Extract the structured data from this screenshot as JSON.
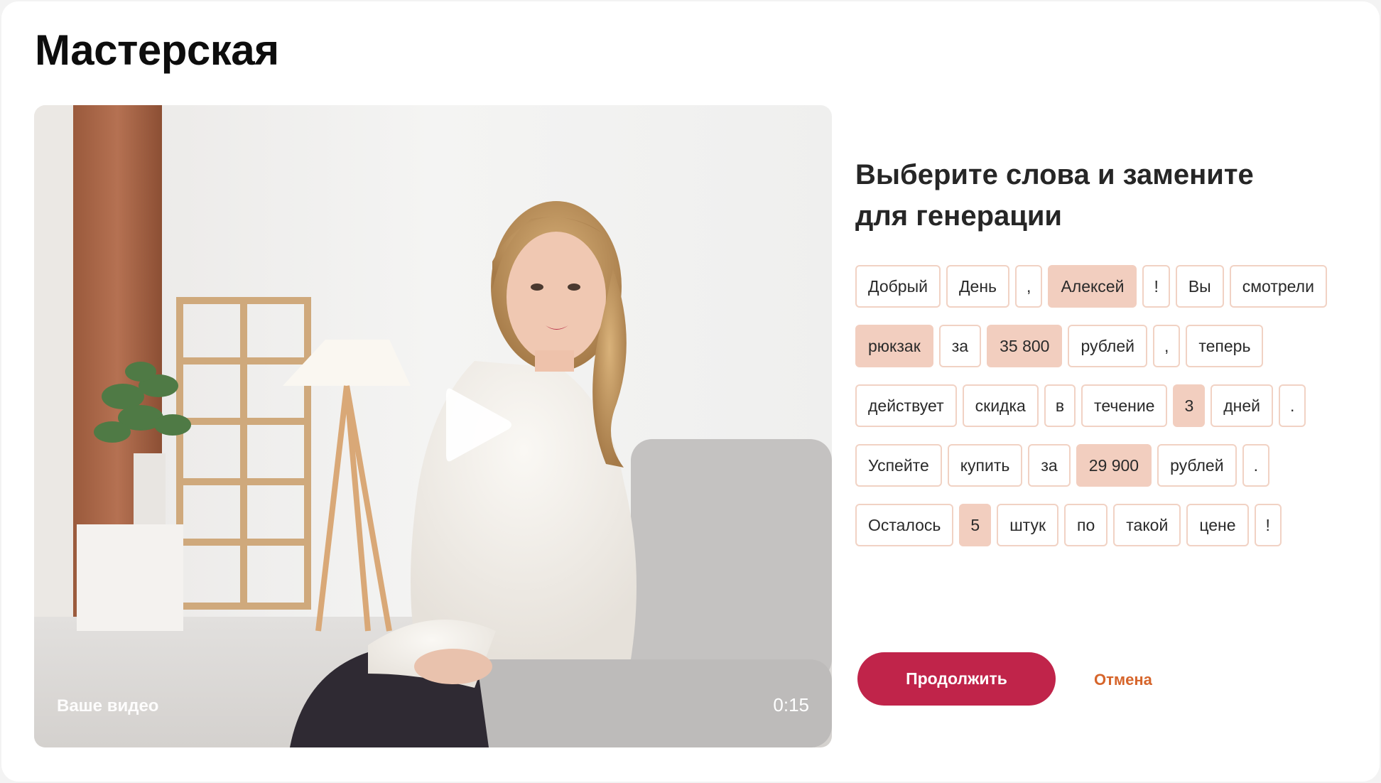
{
  "page": {
    "title": "Мастерская"
  },
  "video": {
    "label": "Ваше видео",
    "duration": "0:15"
  },
  "editor": {
    "heading_line1": "Выберите слова и замените",
    "heading_line2": "для генерации",
    "rows": [
      [
        {
          "text": "Добрый",
          "selected": false
        },
        {
          "text": "День",
          "selected": false
        },
        {
          "text": ",",
          "selected": false
        },
        {
          "text": "Алексей",
          "selected": true
        },
        {
          "text": "!",
          "selected": false
        },
        {
          "text": "Вы",
          "selected": false
        },
        {
          "text": "смотрели",
          "selected": false
        }
      ],
      [
        {
          "text": "рюкзак",
          "selected": true
        },
        {
          "text": "за",
          "selected": false
        },
        {
          "text": "35 800",
          "selected": true
        },
        {
          "text": "рублей",
          "selected": false
        },
        {
          "text": ",",
          "selected": false
        },
        {
          "text": "теперь",
          "selected": false
        }
      ],
      [
        {
          "text": "действует",
          "selected": false
        },
        {
          "text": "скидка",
          "selected": false
        },
        {
          "text": "в",
          "selected": false
        },
        {
          "text": "течение",
          "selected": false
        },
        {
          "text": "3",
          "selected": true
        },
        {
          "text": "дней",
          "selected": false
        },
        {
          "text": ".",
          "selected": false
        }
      ],
      [
        {
          "text": "Успейте",
          "selected": false
        },
        {
          "text": "купить",
          "selected": false
        },
        {
          "text": "за",
          "selected": false
        },
        {
          "text": "29 900",
          "selected": true
        },
        {
          "text": "рублей",
          "selected": false
        },
        {
          "text": ".",
          "selected": false
        }
      ],
      [
        {
          "text": "Осталось",
          "selected": false
        },
        {
          "text": "5",
          "selected": true
        },
        {
          "text": "штук",
          "selected": false
        },
        {
          "text": "по",
          "selected": false
        },
        {
          "text": "такой",
          "selected": false
        },
        {
          "text": "цене",
          "selected": false
        },
        {
          "text": "!",
          "selected": false
        }
      ]
    ]
  },
  "actions": {
    "continue_label": "Продолжить",
    "cancel_label": "Отмена"
  },
  "colors": {
    "accent": "#c0244a",
    "cancel": "#d6652b",
    "chip_selected": "#f2cebf",
    "chip_border": "#f1d2c4"
  }
}
